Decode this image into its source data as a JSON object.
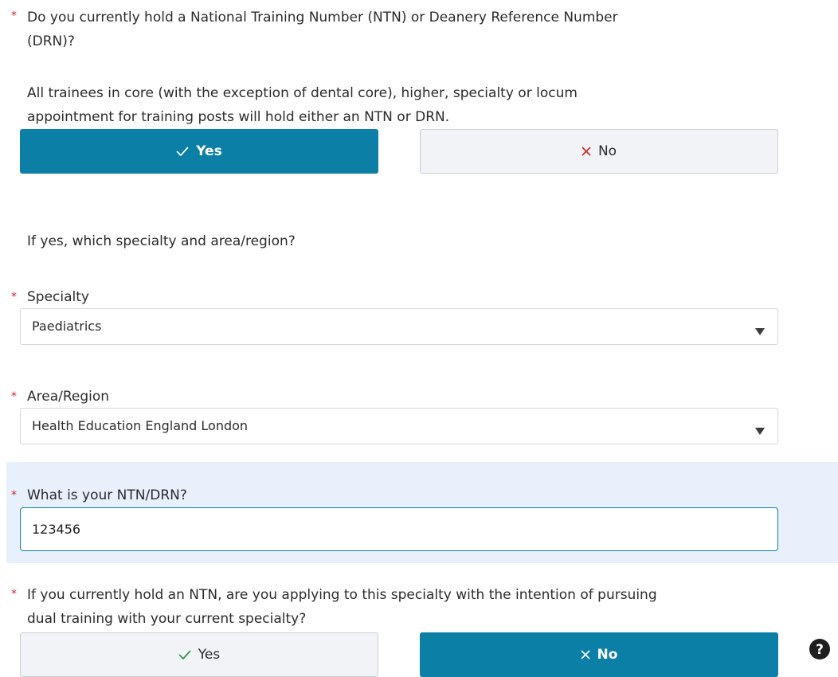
{
  "ntn_question": {
    "required_marker": "*",
    "text_line1": "Do you currently hold a National Training Number (NTN) or Deanery Reference Number",
    "text_line2": "(DRN)?",
    "info_line1": "All trainees in core (with the exception of dental core), higher, specialty or locum",
    "info_line2": "appointment for training posts will hold either an NTN or DRN.",
    "yes_label": "Yes",
    "no_label": "No",
    "selected": "Yes"
  },
  "if_yes_text": "If yes, which specialty and area/region?",
  "specialty": {
    "required_marker": "*",
    "label": "Specialty",
    "value": "Paediatrics"
  },
  "area_region": {
    "required_marker": "*",
    "label": "Area/Region",
    "value": "Health Education England London"
  },
  "ntn_drn": {
    "required_marker": "*",
    "label": "What is your NTN/DRN?",
    "value": "123456"
  },
  "dual_training": {
    "required_marker": "*",
    "text_line1": "If you currently hold an NTN, are you applying to this specialty with the intention of pursuing",
    "text_line2": "dual training with your current specialty?",
    "yes_label": "Yes",
    "no_label": "No",
    "selected": "No"
  },
  "colors": {
    "accent": "#0b7fa6",
    "required": "#d0262b",
    "highlight_band": "#e8f0fb",
    "unselected_button": "#f1f3f6"
  },
  "icons": {
    "check": "check-icon",
    "cross": "cross-icon",
    "dropdown": "chevron-down-icon",
    "help": "help-icon"
  }
}
